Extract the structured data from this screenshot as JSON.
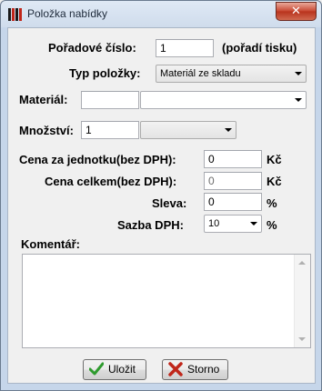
{
  "window": {
    "title": "Položka nabídky",
    "close_label": "✕"
  },
  "form": {
    "poradove_cislo_label": "Pořadové číslo:",
    "poradove_cislo_value": "1",
    "poradi_tisku_hint": "(pořadí tisku)",
    "typ_polozky_label": "Typ položky:",
    "typ_polozky_value": "Materiál ze skladu",
    "material_label": "Materiál:",
    "material_code_value": "",
    "material_select_value": "",
    "mnozstvi_label": "Množství:",
    "mnozstvi_value": "1",
    "mnozstvi_unit_value": "",
    "cena_jednotka_label": "Cena za jednotku(bez DPH):",
    "cena_jednotka_value": "0",
    "cena_jednotka_currency": "Kč",
    "cena_celkem_label": "Cena celkem(bez DPH):",
    "cena_celkem_value": "0",
    "cena_celkem_currency": "Kč",
    "sleva_label": "Sleva:",
    "sleva_value": "0",
    "sleva_unit": "%",
    "sazba_dph_label": "Sazba DPH:",
    "sazba_dph_value": "10",
    "sazba_dph_unit": "%",
    "komentar_label": "Komentář:",
    "komentar_value": ""
  },
  "buttons": {
    "save_label": "Uložit",
    "cancel_label": "Storno"
  },
  "colors": {
    "save_icon": "#2e9b2e",
    "cancel_icon": "#c0261a"
  }
}
